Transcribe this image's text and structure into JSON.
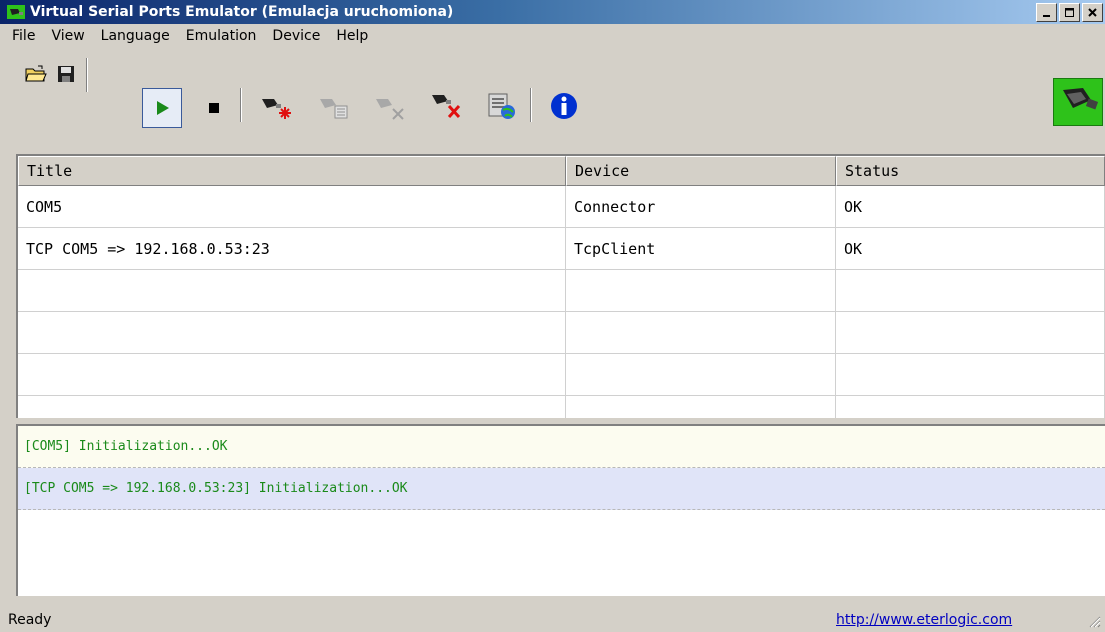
{
  "window": {
    "title": "Virtual Serial Ports Emulator (Emulacja uruchomiona)",
    "buttons": [
      "_",
      "□",
      "×"
    ]
  },
  "menu": [
    "File",
    "View",
    "Language",
    "Emulation",
    "Device",
    "Help"
  ],
  "toolbar": {
    "icons": [
      "open-folder-icon",
      "save-icon",
      "play-icon",
      "stop-icon",
      "new-device-icon",
      "device-properties-icon",
      "device-disabled-icon",
      "delete-device-icon",
      "network-settings-icon",
      "info-icon"
    ]
  },
  "grid": {
    "headers": [
      "Title",
      "Device",
      "Status"
    ],
    "rows": [
      [
        "COM5",
        "Connector",
        "OK"
      ],
      [
        "TCP COM5 => 192.168.0.53:23",
        "TcpClient",
        "OK"
      ],
      [
        "",
        "",
        ""
      ],
      [
        "",
        "",
        ""
      ],
      [
        "",
        "",
        ""
      ],
      [
        "",
        "",
        ""
      ]
    ]
  },
  "log": [
    "[COM5] Initialization...OK",
    "[TCP COM5 => 192.168.0.53:23] Initialization...OK"
  ],
  "status": {
    "text": "Ready",
    "link": "http://www.eterlogic.com"
  },
  "colors": {
    "title_bar": "#0a246a",
    "log_text": "#1a8a1a",
    "play": "#1a8a1a",
    "info": "#0030d0",
    "logo": "#2ec21a"
  }
}
